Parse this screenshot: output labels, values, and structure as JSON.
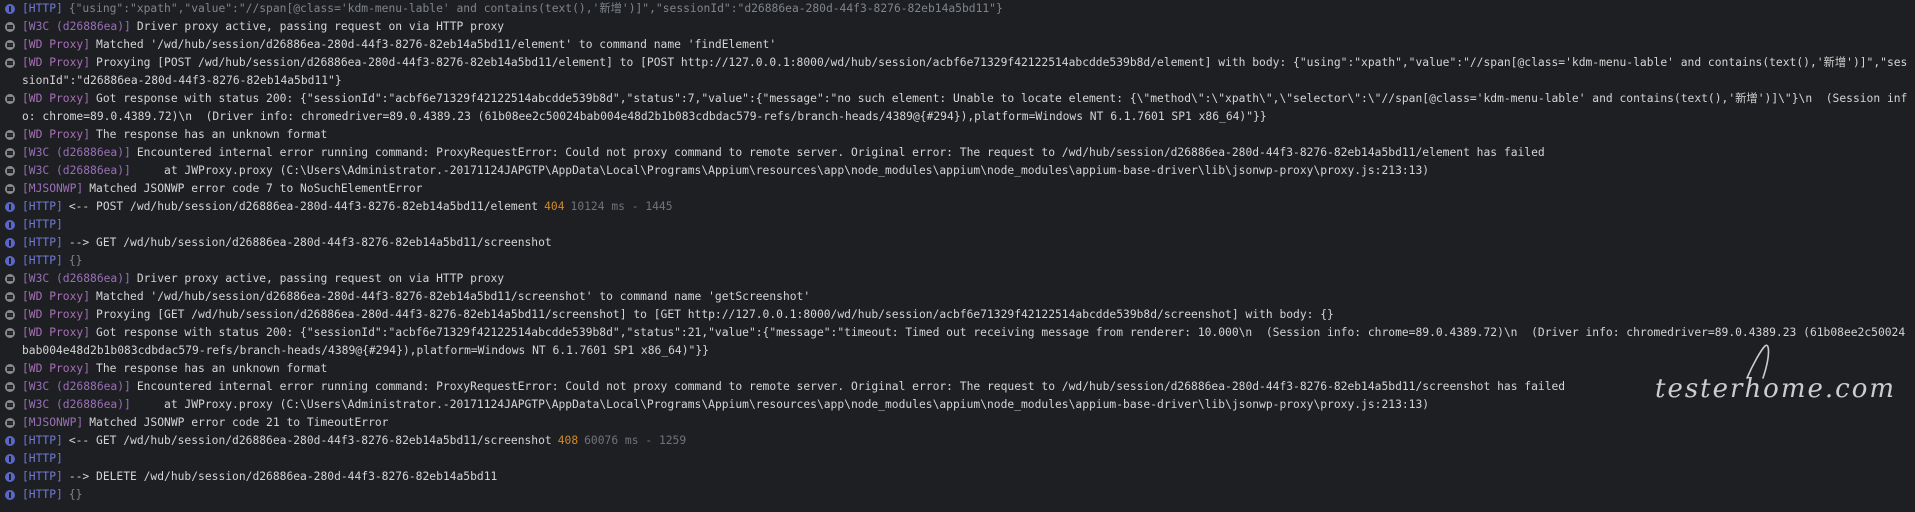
{
  "log_lines": [
    {
      "icon": "info-icon",
      "prefix": "[HTTP]",
      "prefix_type": "http",
      "message": "{\"using\":\"xpath\",\"value\":\"//span[@class='kdm-menu-lable' and contains(text(),'新增')]\",\"sessionId\":\"d26886ea-280d-44f3-8276-82eb14a5bd11\"}",
      "dim": true
    },
    {
      "icon": "debug-icon",
      "prefix": "[W3C (d26886ea)]",
      "prefix_type": "w3c",
      "message": "Driver proxy active, passing request on via HTTP proxy"
    },
    {
      "icon": "debug-icon",
      "prefix": "[WD Proxy]",
      "prefix_type": "wdproxy",
      "message": "Matched '/wd/hub/session/d26886ea-280d-44f3-8276-82eb14a5bd11/element' to command name 'findElement'"
    },
    {
      "icon": "debug-icon",
      "prefix": "[WD Proxy]",
      "prefix_type": "wdproxy",
      "message": "Proxying [POST /wd/hub/session/d26886ea-280d-44f3-8276-82eb14a5bd11/element] to [POST http://127.0.0.1:8000/wd/hub/session/acbf6e71329f42122514abcdde539b8d/element] with body: {\"using\":\"xpath\",\"value\":\"//span[@class='kdm-menu-lable' and contains(text(),'新增')]\",\"sessionId\":\"d26886ea-280d-44f3-8276-82eb14a5bd11\"}",
      "wrapped": true
    },
    {
      "icon": "debug-icon",
      "prefix": "[WD Proxy]",
      "prefix_type": "wdproxy",
      "message": "Got response with status 200: {\"sessionId\":\"acbf6e71329f42122514abcdde539b8d\",\"status\":7,\"value\":{\"message\":\"no such element: Unable to locate element: {\\\"method\\\":\\\"xpath\\\",\\\"selector\\\":\\\"//span[@class='kdm-menu-lable' and contains(text(),'新增')]\\\"}\\n  (Session info: chrome=89.0.4389.72)\\n  (Driver info: chromedriver=89.0.4389.23 (61b08ee2c50024bab004e48d2b1b083cdbdac579-refs/branch-heads/4389@{#294}),platform=Windows NT 6.1.7601 SP1 x86_64)\"}}",
      "wrapped": true
    },
    {
      "icon": "debug-icon",
      "prefix": "[WD Proxy]",
      "prefix_type": "wdproxy",
      "message": "The response has an unknown format"
    },
    {
      "icon": "debug-icon",
      "prefix": "[W3C (d26886ea)]",
      "prefix_type": "w3c",
      "message": "Encountered internal error running command: ProxyRequestError: Could not proxy command to remote server. Original error: The request to /wd/hub/session/d26886ea-280d-44f3-8276-82eb14a5bd11/element has failed"
    },
    {
      "icon": "debug-icon",
      "prefix": "[W3C (d26886ea)]",
      "prefix_type": "w3c",
      "message": "    at JWProxy.proxy (C:\\Users\\Administrator.-20171124JAPGTP\\AppData\\Local\\Programs\\Appium\\resources\\app\\node_modules\\appium\\node_modules\\appium-base-driver\\lib\\jsonwp-proxy\\proxy.js:213:13)"
    },
    {
      "icon": "debug-icon",
      "prefix": "[MJSONWP]",
      "prefix_type": "mjsonwp",
      "message": "Matched JSONWP error code 7 to NoSuchElementError"
    },
    {
      "icon": "info-icon",
      "prefix": "[HTTP]",
      "prefix_type": "http",
      "message": "<-- POST /wd/hub/session/d26886ea-280d-44f3-8276-82eb14a5bd11/element",
      "status": "404",
      "timing": "10124 ms - 1445"
    },
    {
      "icon": "info-icon",
      "prefix": "[HTTP]",
      "prefix_type": "http",
      "message": ""
    },
    {
      "icon": "info-icon",
      "prefix": "[HTTP]",
      "prefix_type": "http",
      "message": "--> GET /wd/hub/session/d26886ea-280d-44f3-8276-82eb14a5bd11/screenshot"
    },
    {
      "icon": "info-icon",
      "prefix": "[HTTP]",
      "prefix_type": "http",
      "message": "{}",
      "dim": true
    },
    {
      "icon": "debug-icon",
      "prefix": "[W3C (d26886ea)]",
      "prefix_type": "w3c",
      "message": "Driver proxy active, passing request on via HTTP proxy"
    },
    {
      "icon": "debug-icon",
      "prefix": "[WD Proxy]",
      "prefix_type": "wdproxy",
      "message": "Matched '/wd/hub/session/d26886ea-280d-44f3-8276-82eb14a5bd11/screenshot' to command name 'getScreenshot'"
    },
    {
      "icon": "debug-icon",
      "prefix": "[WD Proxy]",
      "prefix_type": "wdproxy",
      "message": "Proxying [GET /wd/hub/session/d26886ea-280d-44f3-8276-82eb14a5bd11/screenshot] to [GET http://127.0.0.1:8000/wd/hub/session/acbf6e71329f42122514abcdde539b8d/screenshot] with body: {}"
    },
    {
      "icon": "debug-icon",
      "prefix": "[WD Proxy]",
      "prefix_type": "wdproxy",
      "message": "Got response with status 200: {\"sessionId\":\"acbf6e71329f42122514abcdde539b8d\",\"status\":21,\"value\":{\"message\":\"timeout: Timed out receiving message from renderer: 10.000\\n  (Session info: chrome=89.0.4389.72)\\n  (Driver info: chromedriver=89.0.4389.23 (61b08ee2c50024bab004e48d2b1b083cdbdac579-refs/branch-heads/4389@{#294}),platform=Windows NT 6.1.7601 SP1 x86_64)\"}}",
      "wrapped": true
    },
    {
      "icon": "debug-icon",
      "prefix": "[WD Proxy]",
      "prefix_type": "wdproxy",
      "message": "The response has an unknown format"
    },
    {
      "icon": "debug-icon",
      "prefix": "[W3C (d26886ea)]",
      "prefix_type": "w3c",
      "message": "Encountered internal error running command: ProxyRequestError: Could not proxy command to remote server. Original error: The request to /wd/hub/session/d26886ea-280d-44f3-8276-82eb14a5bd11/screenshot has failed"
    },
    {
      "icon": "debug-icon",
      "prefix": "[W3C (d26886ea)]",
      "prefix_type": "w3c",
      "message": "    at JWProxy.proxy (C:\\Users\\Administrator.-20171124JAPGTP\\AppData\\Local\\Programs\\Appium\\resources\\app\\node_modules\\appium\\node_modules\\appium-base-driver\\lib\\jsonwp-proxy\\proxy.js:213:13)"
    },
    {
      "icon": "debug-icon",
      "prefix": "[MJSONWP]",
      "prefix_type": "mjsonwp",
      "message": "Matched JSONWP error code 21 to TimeoutError"
    },
    {
      "icon": "info-icon",
      "prefix": "[HTTP]",
      "prefix_type": "http",
      "message": "<-- GET /wd/hub/session/d26886ea-280d-44f3-8276-82eb14a5bd11/screenshot",
      "status": "408",
      "timing": "60076 ms - 1259"
    },
    {
      "icon": "info-icon",
      "prefix": "[HTTP]",
      "prefix_type": "http",
      "message": ""
    },
    {
      "icon": "info-icon",
      "prefix": "[HTTP]",
      "prefix_type": "http",
      "message": "--> DELETE /wd/hub/session/d26886ea-280d-44f3-8276-82eb14a5bd11"
    },
    {
      "icon": "info-icon",
      "prefix": "[HTTP]",
      "prefix_type": "http",
      "message": "{}",
      "dim": true
    }
  ],
  "watermark": {
    "text": "testerhome.com"
  },
  "colors": {
    "background": "#1e1f22",
    "http_prefix": "#7179d6",
    "w3c_prefix": "#9a6fb8",
    "status_code": "#d08a2a",
    "timing": "#6f747a"
  }
}
